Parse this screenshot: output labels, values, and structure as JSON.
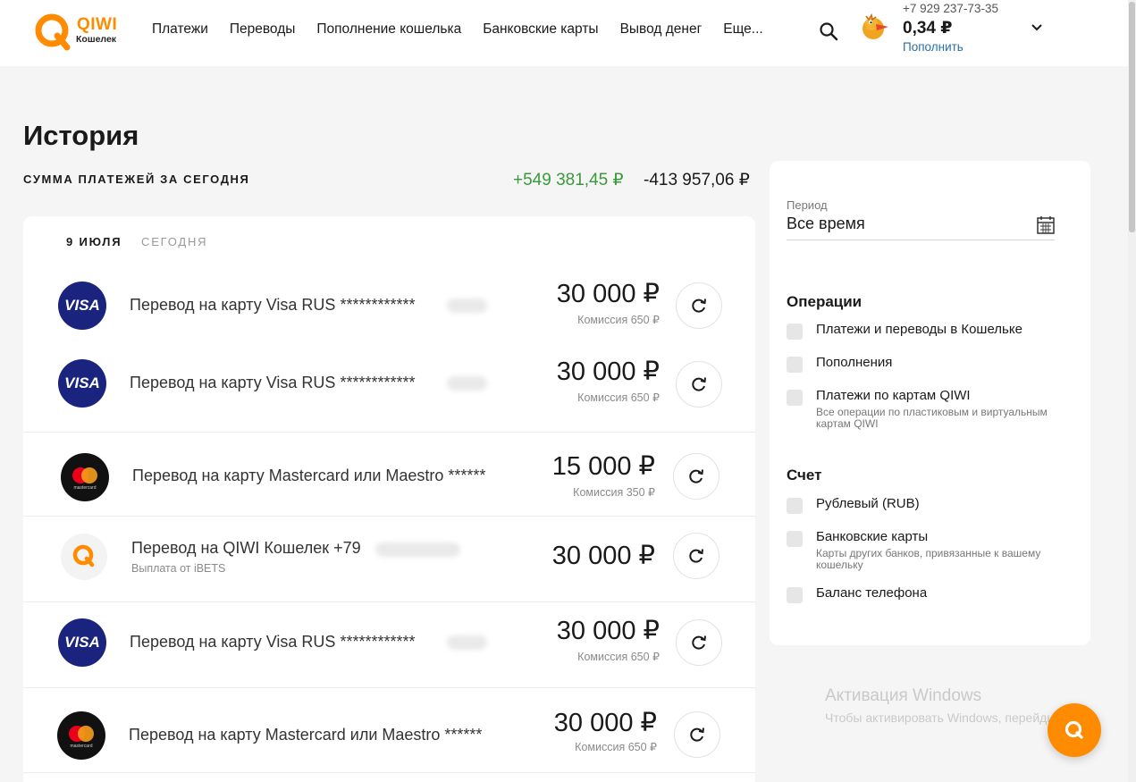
{
  "header": {
    "logo_text": "QIWI",
    "logo_sub": "Кошелек",
    "nav": [
      "Платежи",
      "Переводы",
      "Пополнение кошелька",
      "Банковские карты",
      "Вывод денег",
      "Еще..."
    ],
    "phone": "+7 929 237-73-35",
    "balance": "0,34 ₽",
    "topup": "Пополнить"
  },
  "page": {
    "title": "История",
    "sum_label": "СУММА ПЛАТЕЖЕЙ ЗА СЕГОДНЯ",
    "sum_plus": "+549 381,45 ₽",
    "sum_minus": "-413 957,06 ₽"
  },
  "history": {
    "date_label": "9 ИЮЛЯ",
    "date_sub": "СЕГОДНЯ",
    "transactions": [
      {
        "type": "visa",
        "icon_text": "VISA",
        "name": "Перевод на карту Visa RUS ************",
        "amount": "30 000 ₽",
        "fee": "Комиссия 650 ₽"
      },
      {
        "type": "visa",
        "icon_text": "VISA",
        "name": "Перевод на карту Visa RUS ************",
        "amount": "30 000 ₽",
        "fee": "Комиссия 650 ₽"
      },
      {
        "type": "mastercard",
        "name": "Перевод на карту Mastercard или Maestro ******",
        "amount": "15 000 ₽",
        "fee": "Комиссия 350 ₽"
      },
      {
        "type": "qiwi",
        "name": "Перевод на QIWI Кошелек +79",
        "sub": "Выплата от iBETS",
        "amount": "30 000 ₽"
      },
      {
        "type": "visa",
        "icon_text": "VISA",
        "name": "Перевод на карту Visa RUS ************",
        "amount": "30 000 ₽",
        "fee": "Комиссия 650 ₽"
      },
      {
        "type": "mastercard",
        "name": "Перевод на карту Mastercard или Maestro ******",
        "amount": "30 000 ₽",
        "fee": "Комиссия 650 ₽"
      }
    ]
  },
  "filter": {
    "period_label": "Период",
    "period_value": "Все время",
    "operations_title": "Операции",
    "operations": [
      {
        "label": "Платежи и переводы в Кошельке"
      },
      {
        "label": "Пополнения"
      },
      {
        "label": "Платежи по картам QIWI",
        "hint": "Все операции по пластиковым и виртуальным картам QIWI"
      }
    ],
    "account_title": "Счет",
    "accounts": [
      {
        "label": "Рублевый (RUB)"
      },
      {
        "label": "Банковские карты",
        "hint": "Карты других банков, привязанные к вашему кошельку"
      },
      {
        "label": "Баланс телефона"
      }
    ]
  },
  "watermark": {
    "title": "Активация Windows",
    "text": "Чтобы активировать Windows, перейдите к параметрам компьютера."
  },
  "colors": {
    "accent": "#ff8c00",
    "positive": "#3a9a3a",
    "visa": "#1a237e",
    "link": "#2a6fa8"
  }
}
